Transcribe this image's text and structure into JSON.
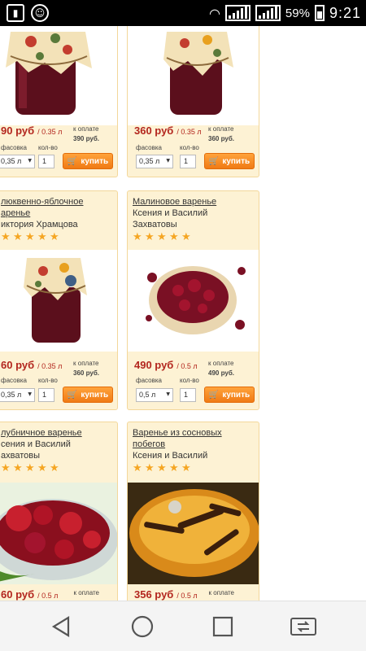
{
  "statusbar": {
    "battery_percent": "59%",
    "time": "9:21",
    "icons": [
      "sim-card-icon",
      "notification-icon",
      "wifi-icon",
      "signal-icon",
      "signal-icon",
      "battery-icon"
    ]
  },
  "products": [
    {
      "title": "",
      "author": "",
      "price": "90 руб",
      "unit": "/ 0.35 л",
      "pay_label": "к оплате",
      "pay_value": "390 руб.",
      "pack_label": "фасовка",
      "qty_label": "кол-во",
      "pack_value": "0,35 л",
      "qty_value": "1",
      "buy_label": "купить"
    },
    {
      "title": "",
      "author": "",
      "price": "360 руб",
      "unit": "/ 0.35 л",
      "pay_label": "к оплате",
      "pay_value": "360 руб.",
      "pack_label": "фасовка",
      "qty_label": "кол-во",
      "pack_value": "0,35 л",
      "qty_value": "1",
      "buy_label": "купить"
    },
    {
      "title_line1": "люквенно-яблочное",
      "title_line2": "аренье",
      "author": "иктория Храмцова",
      "price": "60 руб",
      "unit": "/ 0.35 л",
      "pay_label": "к оплате",
      "pay_value": "360 руб.",
      "pack_label": "фасовка",
      "qty_label": "кол-во",
      "pack_value": "0,35 л",
      "qty_value": "1",
      "buy_label": "купить"
    },
    {
      "title_line1": "Малиновое варенье",
      "title_line2": "",
      "author_line1": "Ксения и Василий",
      "author_line2": "Захватовы",
      "price": "490 руб",
      "unit": "/ 0.5 л",
      "pay_label": "к оплате",
      "pay_value": "490 руб.",
      "pack_label": "фасовка",
      "qty_label": "кол-во",
      "pack_value": "0,5 л",
      "qty_value": "1",
      "buy_label": "купить"
    },
    {
      "title_line1": "лубничное варенье",
      "author_line1": "сения и Василий",
      "author_line2": "ахватовы",
      "price": "60 руб",
      "unit": "/ 0.5 л",
      "pay_label": "к оплате"
    },
    {
      "title_line1": "Варенье из сосновых",
      "title_line2": "побегов",
      "author_line1": "Ксения и Василий",
      "price": "356 руб",
      "unit": "/ 0.5 л",
      "pay_label": "к оплате"
    }
  ],
  "rating_stars": 5,
  "colors": {
    "card_bg": "#fdf2d4",
    "price": "#b3261e",
    "buy_button": "#f07a14",
    "star": "#f5a623"
  },
  "navbar": {
    "icons": [
      "back-icon",
      "home-icon",
      "recents-icon",
      "switch-apps-icon"
    ]
  }
}
